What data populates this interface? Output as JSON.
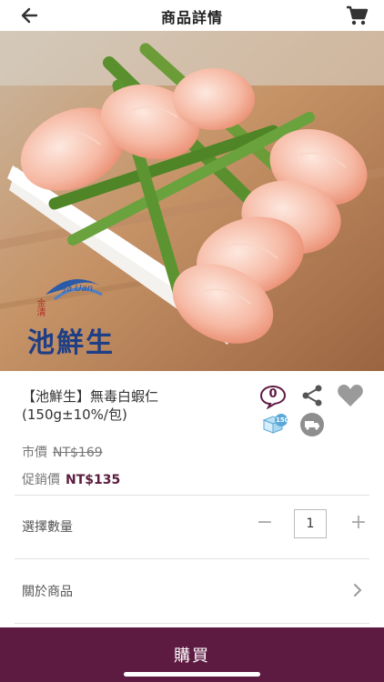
{
  "header": {
    "title": "商品詳情",
    "back_icon": "back-arrow-icon",
    "cart_icon": "cart-icon"
  },
  "product_image": {
    "description_icon": "product-photo",
    "logo_text": "池鮮生",
    "logo_small": "Ja Uan",
    "logo_seal": "金清"
  },
  "product": {
    "title": "【池鮮生】無毒白蝦仁(150g±10%/包)",
    "comment_count": "0",
    "shipping_tag": "150"
  },
  "pricing": {
    "market_label": "市價",
    "market_price": "NT$169",
    "promo_label": "促銷價",
    "promo_price": "NT$135"
  },
  "quantity": {
    "label": "選擇數量",
    "value": "1",
    "minus": "−",
    "plus": "+"
  },
  "about": {
    "label": "關於商品"
  },
  "buy": {
    "label": "購買"
  },
  "colors": {
    "accent": "#5e1b42",
    "price": "#5b1c3f"
  }
}
